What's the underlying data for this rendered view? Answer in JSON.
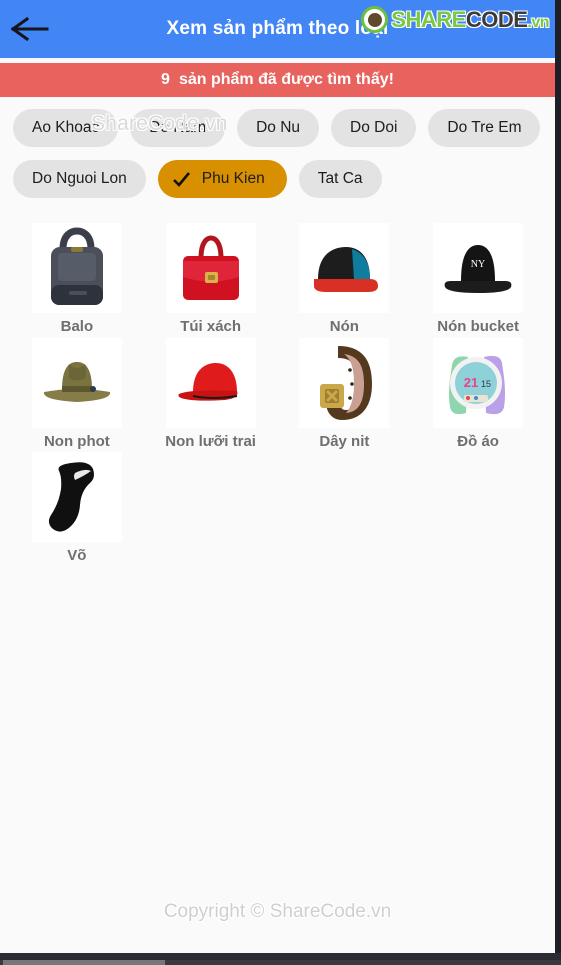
{
  "header": {
    "title": "Xem sản phẩm theo loại",
    "back_icon": "arrow-left-icon",
    "bg_color": "#4285f4"
  },
  "watermark": {
    "text": "ShareCode.vn",
    "footer": "Copyright © ShareCode.vn",
    "logo": {
      "mark_icon": "sharecode-logo-icon",
      "part1": "SHARE",
      "part2": "CODE",
      "part3": ".vn",
      "green": "#7ac943",
      "dark": "#3b3b3b"
    }
  },
  "result_banner": {
    "count": "9",
    "message": "sản phẩm đã được tìm thấy!",
    "bg_color": "#e8625e"
  },
  "filters": {
    "selected_color": "#d89000",
    "unselected_color": "#e3e3e3",
    "check_icon": "check-icon",
    "rows": [
      [
        {
          "label": "Ao Khoac",
          "selected": false
        },
        {
          "label": "Do Nam",
          "selected": false
        },
        {
          "label": "Do Nu",
          "selected": false
        },
        {
          "label": "Do Doi",
          "selected": false
        },
        {
          "label": "Do Tre Em",
          "selected": false
        }
      ],
      [
        {
          "label": "Do Nguoi Lon",
          "selected": false
        },
        {
          "label": "Phu Kien",
          "selected": true
        },
        {
          "label": "Tat Ca",
          "selected": false
        }
      ]
    ]
  },
  "products": [
    {
      "label": "Balo",
      "image": "backpack-image"
    },
    {
      "label": "Túi xách",
      "image": "handbag-image"
    },
    {
      "label": "Nón",
      "image": "snapback-cap-image"
    },
    {
      "label": "Nón bucket",
      "image": "bucket-hat-image"
    },
    {
      "label": "Non phot",
      "image": "fedora-hat-image"
    },
    {
      "label": "Non lưỡi trai",
      "image": "baseball-cap-image"
    },
    {
      "label": "Dây nit",
      "image": "belt-image"
    },
    {
      "label": "Đồ áo",
      "image": "smartwatch-image"
    },
    {
      "label": "Võ",
      "image": "sock-image"
    }
  ]
}
